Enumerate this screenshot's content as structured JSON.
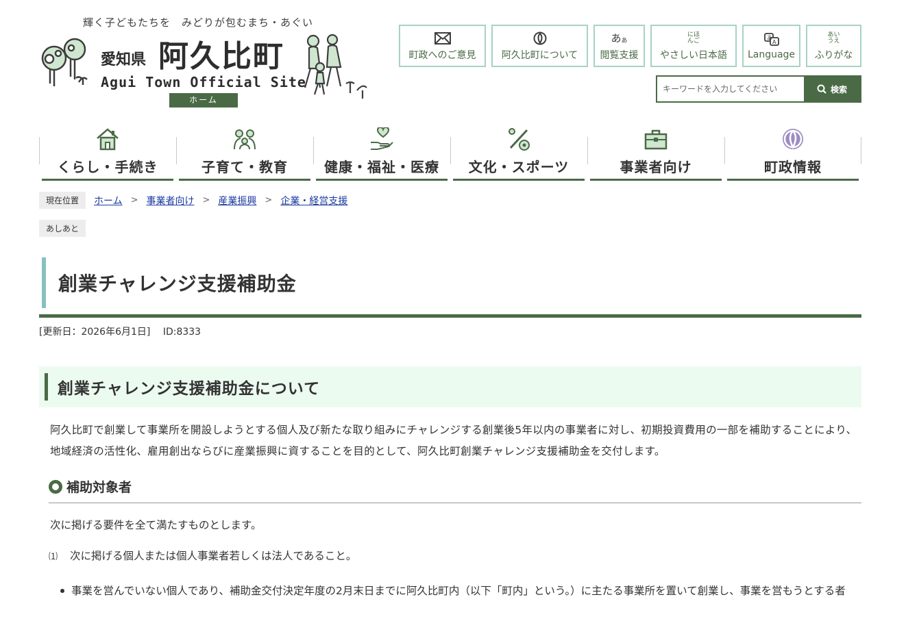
{
  "header": {
    "tagline": "輝く子どもたちを　みどりが包むまち・あぐい",
    "prefecture": "愛知県",
    "town_name": "阿久比町",
    "english_name": "Agui Town Official Site",
    "home_label": "ホーム"
  },
  "utility_nav": [
    {
      "label": "町政へのご意見",
      "icon": "mail-icon"
    },
    {
      "label": "阿久比町について",
      "icon": "town-emblem-icon"
    },
    {
      "label": "閲覧支援",
      "icon": "font-size-icon",
      "icon_text": "あ"
    },
    {
      "label": "やさしい日本語",
      "ruby": "にほ\nんご",
      "icon": "ruby-icon"
    },
    {
      "label": "Language",
      "icon": "translate-icon"
    },
    {
      "label": "ふりがな",
      "ruby": "あい\nうえ",
      "icon": "furigana-icon"
    }
  ],
  "search": {
    "placeholder": "キーワードを入力してください",
    "button_label": "検索"
  },
  "global_nav": [
    {
      "label": "くらし・手続き",
      "icon": "house-icon"
    },
    {
      "label": "子育て・教育",
      "icon": "family-icon"
    },
    {
      "label": "健康・福祉・医療",
      "icon": "heart-hand-icon"
    },
    {
      "label": "文化・スポーツ",
      "icon": "sports-icon"
    },
    {
      "label": "事業者向け",
      "icon": "briefcase-icon"
    },
    {
      "label": "町政情報",
      "icon": "town-emblem-icon"
    }
  ],
  "breadcrumb": {
    "current_label": "現在位置",
    "items": [
      "ホーム",
      "事業者向け",
      "産業振興",
      "企業・経営支援"
    ]
  },
  "ashiato_label": "あしあと",
  "page": {
    "title": "創業チャレンジ支援補助金",
    "meta": "[更新日：2026年6月1日]　 ID:8333",
    "section_heading": "創業チャレンジ支援補助金について",
    "intro": "阿久比町で創業して事業所を開設しようとする個人及び新たな取り組みにチャレンジする創業後5年以内の事業者に対し、初期投資費用の一部を補助することにより、地域経済の活性化、雇用創出ならびに産業振興に資することを目的として、阿久比町創業チャレンジ支援補助金を交付します。",
    "subheading": "補助対象者",
    "requirements_intro": "次に掲げる要件を全て満たすものとします。",
    "requirement_1_number": "⑴",
    "requirement_1": "次に掲げる個人または個人事業者若しくは法人であること。",
    "bullets": [
      "事業を営んでいない個人であり、補助金交付決定年度の2月末日までに阿久比町内（以下「町内」という。）に主たる事業所を置いて創業し、事業を営もうとする者"
    ]
  },
  "colors": {
    "brand_green": "#4a6a46",
    "accent_teal": "#86c1c1",
    "button_border": "#a6d2c4",
    "section_bg": "#ecfbf0",
    "link": "#1a3aa0"
  }
}
